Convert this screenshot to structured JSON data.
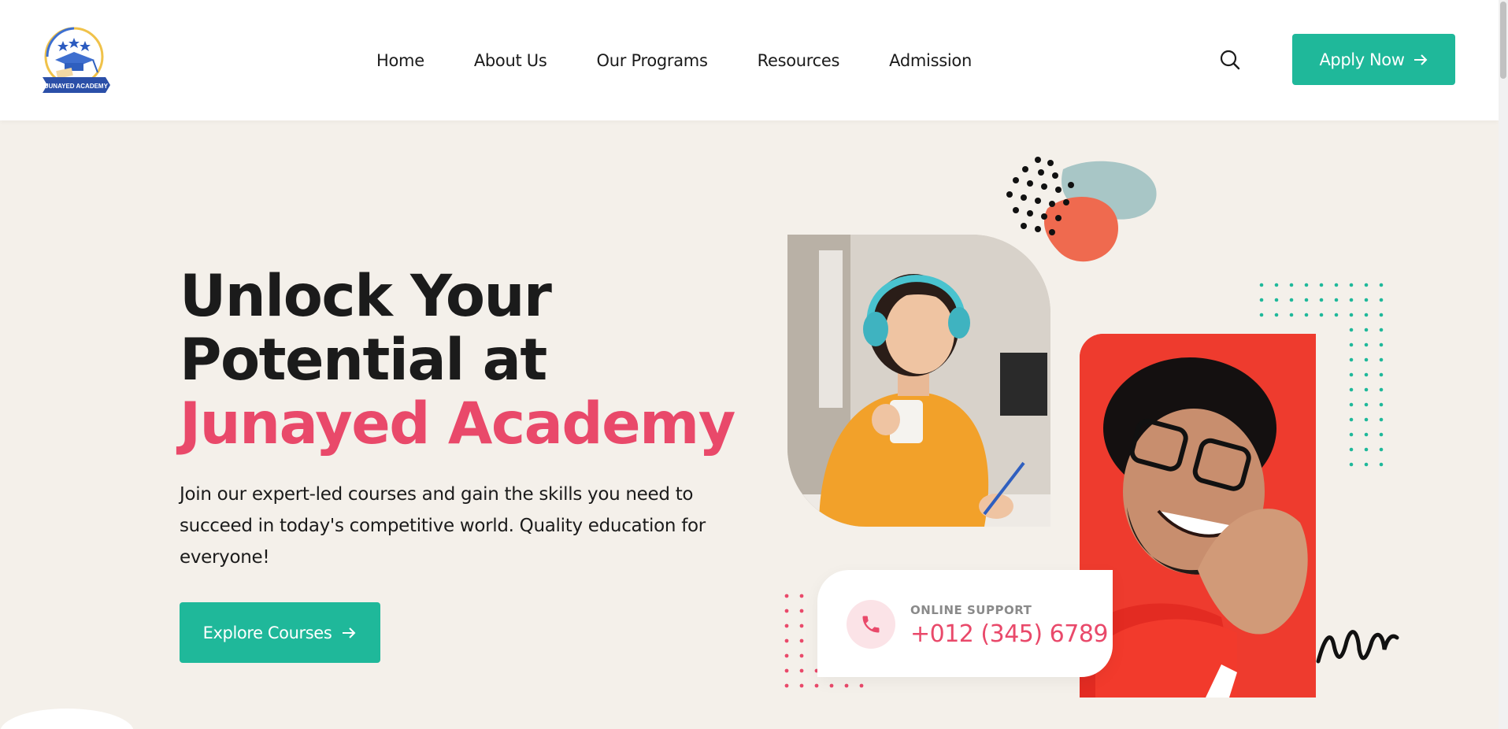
{
  "header": {
    "logo_alt": "Junayed Academy",
    "logo_text": "JUNAYED ACADEMY",
    "nav": [
      {
        "label": "Home"
      },
      {
        "label": "About Us"
      },
      {
        "label": "Our Programs"
      },
      {
        "label": "Resources"
      },
      {
        "label": "Admission"
      }
    ],
    "search_icon": "search-icon",
    "apply_label": "Apply Now",
    "apply_icon": "arrow-right-icon"
  },
  "hero": {
    "title_line1": "Unlock Your",
    "title_line2": "Potential at",
    "title_accent": "Junayed Academy",
    "description": "Join our expert-led courses and gain the skills you need to succeed in today's competitive world. Quality education for everyone!",
    "cta_label": "Explore Courses",
    "cta_icon": "arrow-right-icon"
  },
  "support": {
    "label": "ONLINE SUPPORT",
    "phone": "+012 (345) 6789",
    "icon": "phone-icon"
  },
  "colors": {
    "accent_teal": "#1fb89a",
    "accent_pink": "#e9496a",
    "background": "#f4f0ea",
    "photo2_bg": "#ee3b2e"
  }
}
